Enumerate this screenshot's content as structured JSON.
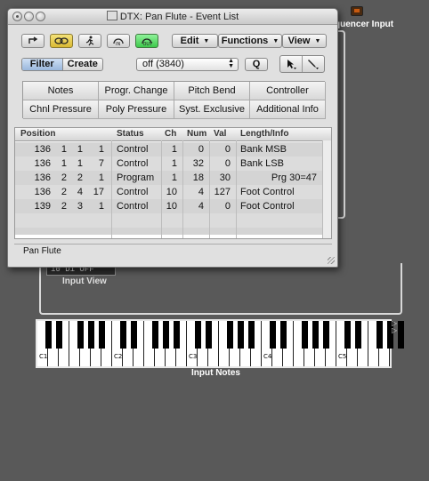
{
  "background": {
    "sequencer_label": "quencer Input",
    "plug_label": "10  D1   OFF",
    "input_view_label": "Input View",
    "input_notes_label": "Input Notes",
    "key_labels": [
      "C1",
      "C2",
      "C3",
      "C4",
      "C5"
    ]
  },
  "window": {
    "title": "DTX: Pan Flute    - Event List"
  },
  "toolbar": {
    "menus": [
      {
        "label": "Edit"
      },
      {
        "label": "Functions"
      },
      {
        "label": "View"
      }
    ],
    "icons": [
      "back-arrow-icon",
      "link-icon",
      "runner-icon",
      "midi-in-icon",
      "midi-out-icon"
    ]
  },
  "filter": {
    "mode_active": "Filter",
    "mode_other": "Create",
    "dropdown_value": "off (3840)",
    "q_label": "Q",
    "event_types": [
      "Notes",
      "Progr. Change",
      "Pitch Bend",
      "Controller",
      "Chnl Pressure",
      "Poly Pressure",
      "Syst. Exclusive",
      "Additional Info"
    ]
  },
  "table": {
    "columns": [
      "Position",
      "Status",
      "Ch",
      "Num",
      "Val",
      "Length/Info"
    ],
    "rows": [
      {
        "bar": "136",
        "beat": "1",
        "div": "1",
        "tick": "1",
        "status": "Control",
        "ch": "1",
        "num": "0",
        "val": "0",
        "info": "Bank MSB"
      },
      {
        "bar": "136",
        "beat": "1",
        "div": "1",
        "tick": "7",
        "status": "Control",
        "ch": "1",
        "num": "32",
        "val": "0",
        "info": "Bank LSB"
      },
      {
        "bar": "136",
        "beat": "2",
        "div": "2",
        "tick": "1",
        "status": "Program",
        "ch": "1",
        "num": "18",
        "val": "30",
        "info": "Prg 30=47"
      },
      {
        "bar": "136",
        "beat": "2",
        "div": "4",
        "tick": "17",
        "status": "Control",
        "ch": "10",
        "num": "4",
        "val": "127",
        "info": "Foot Control"
      },
      {
        "bar": "139",
        "beat": "2",
        "div": "3",
        "tick": "1",
        "status": "Control",
        "ch": "10",
        "num": "4",
        "val": "0",
        "info": "Foot Control"
      }
    ]
  },
  "status_bar": {
    "text": "Pan Flute"
  },
  "colors": {
    "link_button": "#e2c64a",
    "midi_out_button": "#5ed86a",
    "filter_active": "#a9c3e3"
  }
}
